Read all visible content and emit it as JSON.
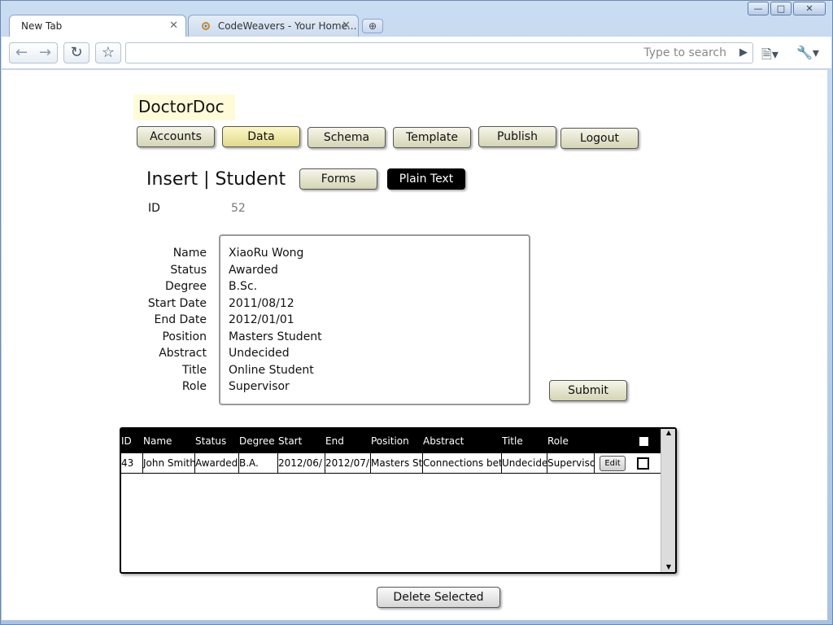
{
  "browser": {
    "tabs": [
      {
        "label": "New Tab",
        "active": true
      },
      {
        "label": "CodeWeavers - Your Home...",
        "active": false
      }
    ],
    "search_placeholder": "Type to search",
    "icons": {
      "back": "arrow-left-icon",
      "forward": "arrow-right-icon",
      "reload": "reload-icon",
      "star": "star-icon",
      "go": "play-icon",
      "page": "page-icon",
      "tools": "wrench-icon"
    }
  },
  "app": {
    "logo": "DoctorDoc",
    "nav": [
      {
        "label": "Accounts",
        "selected": false
      },
      {
        "label": "Data",
        "selected": true
      },
      {
        "label": "Schema",
        "selected": false
      },
      {
        "label": "Template",
        "selected": false
      },
      {
        "label": "Publish",
        "selected": false
      },
      {
        "label": "Logout",
        "selected": false
      }
    ]
  },
  "form": {
    "heading": "Insert | Student",
    "mode_buttons": {
      "forms": "Forms",
      "plain_text": "Plain Text"
    },
    "id_label": "ID",
    "id_value": "52",
    "field_labels": [
      "Name",
      "Status",
      "Degree",
      "Start Date",
      "End Date",
      "Position",
      "Abstract",
      "Title",
      "Role"
    ],
    "field_values": [
      "XiaoRu Wong",
      "Awarded",
      "B.Sc.",
      "2011/08/12",
      "2012/01/01",
      "Masters Student",
      "Undecided",
      "Online Student",
      "Supervisor"
    ],
    "submit_label": "Submit"
  },
  "table": {
    "columns": [
      "ID",
      "Name",
      "Status",
      "Degree",
      "Start",
      "End",
      "Position",
      "Abstract",
      "Title",
      "Role"
    ],
    "rows": [
      {
        "id": "43",
        "name": "John Smith",
        "status": "Awarded",
        "degree": "B.A.",
        "start": "2012/06/",
        "end": "2012/07/",
        "position": "Masters St",
        "abstract": "Connections bet",
        "title": "Undecide",
        "role": "Superviso",
        "edit_label": "Edit"
      }
    ],
    "delete_label": "Delete Selected"
  },
  "colors": {
    "selected_nav": "#e0d98c",
    "logo_bg": "#fffbd9",
    "header_bg": "#000000"
  }
}
